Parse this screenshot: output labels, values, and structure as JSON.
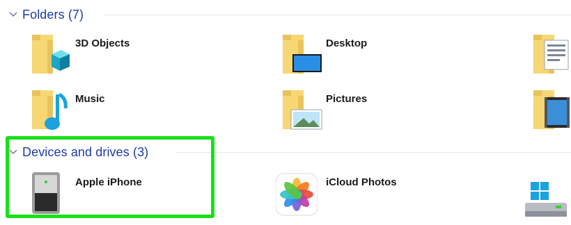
{
  "sections": {
    "folders": {
      "title": "Folders (7)",
      "items": [
        {
          "label": "3D Objects",
          "icon": "3d-objects-folder-icon"
        },
        {
          "label": "Desktop",
          "icon": "desktop-folder-icon"
        },
        {
          "label": "",
          "icon": "documents-folder-icon"
        },
        {
          "label": "Music",
          "icon": "music-folder-icon"
        },
        {
          "label": "Pictures",
          "icon": "pictures-folder-icon"
        },
        {
          "label": "",
          "icon": "videos-folder-icon"
        }
      ]
    },
    "devices": {
      "title": "Devices and drives (3)",
      "items": [
        {
          "label": "Apple iPhone",
          "icon": "iphone-device-icon"
        },
        {
          "label": "iCloud Photos",
          "icon": "icloud-photos-icon"
        },
        {
          "label": "",
          "icon": "local-disk-icon"
        }
      ]
    }
  },
  "colors": {
    "header_text": "#1f3aa8",
    "highlight_border": "#17e117",
    "folder_yellow": "#f7d774"
  }
}
